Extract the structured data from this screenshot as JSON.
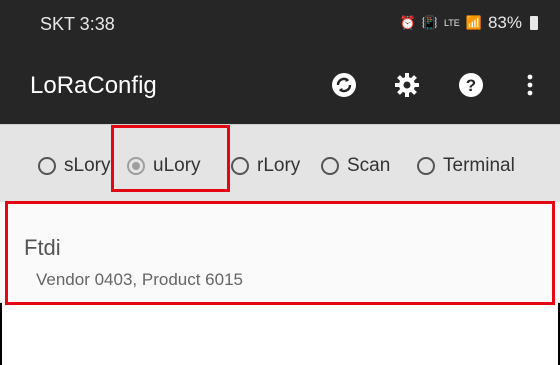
{
  "status_bar": {
    "time": "SKT 3:38",
    "icons": [
      "alarm-icon",
      "vibrate-icon",
      "lte-icon",
      "signal-icon"
    ],
    "lte": "LTE",
    "battery": "83%"
  },
  "app_bar": {
    "title": "LoRaConfig",
    "actions": [
      "sync-icon",
      "settings-icon",
      "help-icon",
      "overflow-menu-icon"
    ]
  },
  "modes": [
    {
      "label": "sLory",
      "checked": false
    },
    {
      "label": "uLory",
      "checked": true
    },
    {
      "label": "rLory",
      "checked": false
    },
    {
      "label": "Scan",
      "checked": false
    },
    {
      "label": "Terminal",
      "checked": false
    }
  ],
  "devices": [
    {
      "name": "Ftdi",
      "detail": "Vendor 0403, Product 6015"
    }
  ],
  "colors": {
    "toolbar": "#262626",
    "radio_bar": "#e4e4e4",
    "highlight": "#e30613"
  }
}
